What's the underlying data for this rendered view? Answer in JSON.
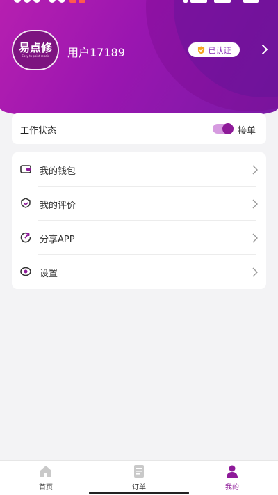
{
  "colors": {
    "brand": "#9a16b0",
    "brand_dark": "#7a1aa6",
    "accent_purple": "#8e1a99",
    "background": "#f3f3f5"
  },
  "header": {
    "avatar_logo_text": "易点修",
    "avatar_logo_sub": "Easy to point repair",
    "username": "用户17189",
    "verified_label": "已认证",
    "verified_icon": "shield-icon",
    "chevron_icon": "chevron-right-icon"
  },
  "work_status": {
    "label": "工作状态",
    "toggle_on": true,
    "toggle_label": "接单"
  },
  "menu": {
    "items": [
      {
        "label": "我的钱包",
        "icon": "wallet-icon"
      },
      {
        "label": "我的评价",
        "icon": "review-icon"
      },
      {
        "label": "分享APP",
        "icon": "share-icon"
      },
      {
        "label": "设置",
        "icon": "settings-icon"
      }
    ]
  },
  "bottom_nav": {
    "items": [
      {
        "label": "首页",
        "icon": "home-icon",
        "active": false
      },
      {
        "label": "订单",
        "icon": "order-icon",
        "active": false
      },
      {
        "label": "我的",
        "icon": "profile-icon",
        "active": true
      }
    ]
  }
}
